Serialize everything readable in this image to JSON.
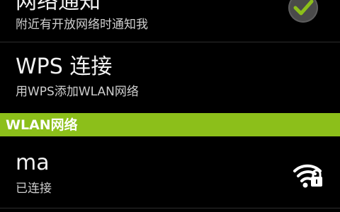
{
  "settings": {
    "network_notify": {
      "title": "网络通知",
      "summary": "附近有开放网络时通知我",
      "checked": true
    },
    "wps": {
      "title": "WPS 连接",
      "summary": "用WPS添加WLAN网络"
    },
    "wlan_section": {
      "header": "WLAN网络",
      "accent_color": "#8cbf1a"
    },
    "networks": [
      {
        "ssid": "ma",
        "status": "已连接",
        "icon": "wifi-lock-icon"
      }
    ]
  }
}
